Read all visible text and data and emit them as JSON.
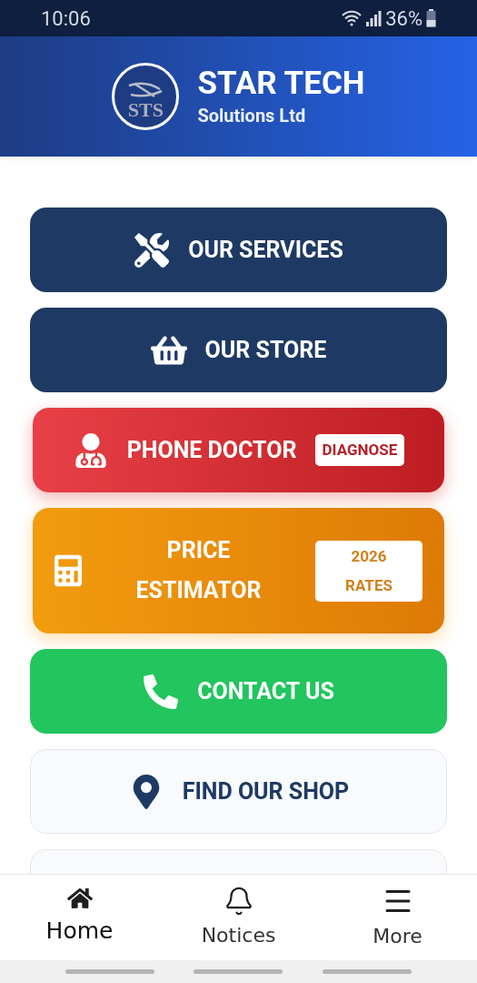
{
  "status_bar": {
    "time": "10:06",
    "battery": "36%"
  },
  "header": {
    "logo_text": "STS",
    "title": "STAR TECH",
    "subtitle": "Solutions Ltd"
  },
  "menu": [
    {
      "kind": "navy",
      "label": "OUR SERVICES"
    },
    {
      "kind": "navy",
      "label": "OUR STORE"
    },
    {
      "kind": "red",
      "label": "PHONE DOCTOR",
      "badge": [
        "DIAGNOSE"
      ]
    },
    {
      "kind": "orange",
      "label": "PRICE ESTIMATOR",
      "badge": [
        "2026",
        "RATES"
      ]
    },
    {
      "kind": "green",
      "label": "CONTACT US"
    },
    {
      "kind": "light",
      "label": "FIND OUR SHOP"
    }
  ],
  "bottom_nav": [
    {
      "label": "Home",
      "selected": true
    },
    {
      "label": "Notices",
      "selected": false
    },
    {
      "label": "More",
      "selected": false
    }
  ]
}
